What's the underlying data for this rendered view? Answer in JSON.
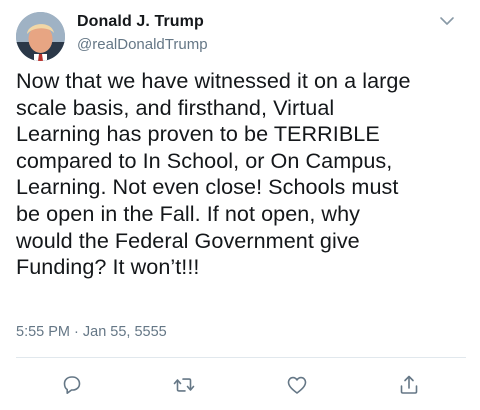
{
  "user": {
    "display_name": "Donald J. Trump",
    "handle": "@realDonaldTrump"
  },
  "tweet": {
    "text": "Now that we have witnessed it on a large\nscale basis, and firsthand, Virtual\nLearning has proven to be TERRIBLE\ncompared to In School, or On Campus,\nLearning. Not even close! Schools must\nbe open in the Fall. If not open, why\nwould the Federal Government give\nFunding? It won’t!!!",
    "timestamp": "5:55 PM · Jan 55, 5555"
  },
  "icons": {
    "avatar": "profile-photo",
    "menu": "chevron-down-icon",
    "reply": "reply-icon",
    "retweet": "retweet-icon",
    "like": "heart-icon",
    "share": "share-icon"
  },
  "colors": {
    "text": "#14171a",
    "secondary": "#657786",
    "divider": "#e1e8ed",
    "icon": "#657786"
  }
}
